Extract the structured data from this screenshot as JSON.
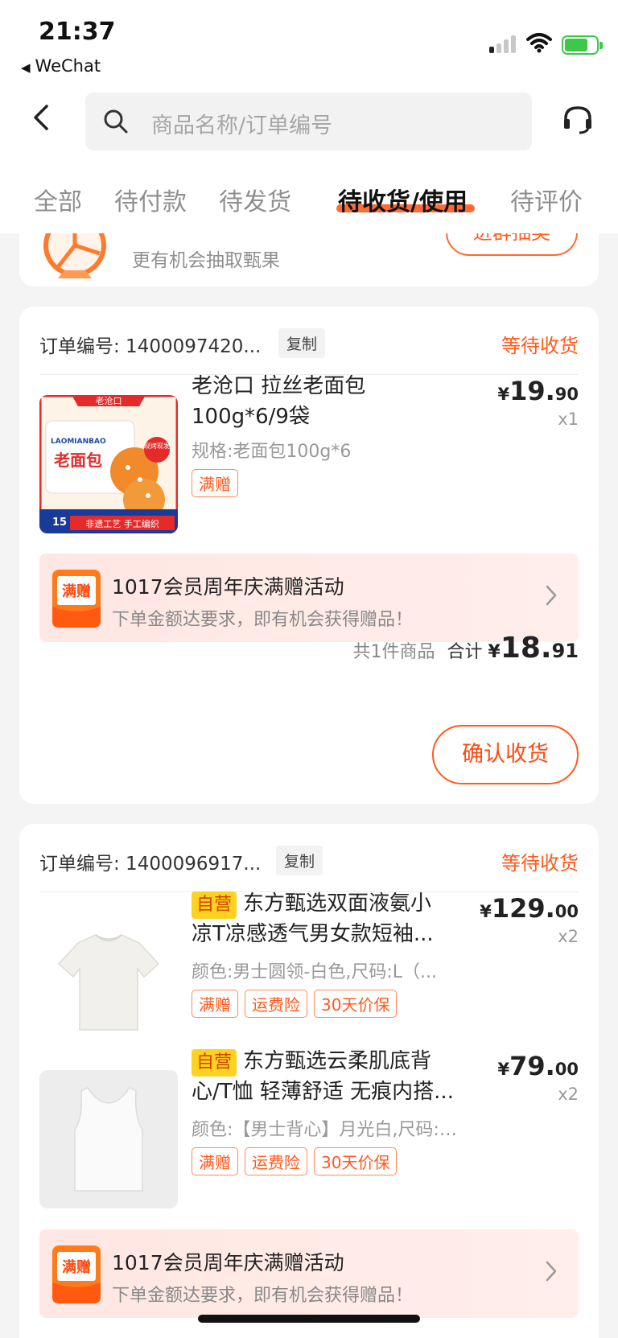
{
  "status_bar": {
    "time": "21:37",
    "back_app": "WeChat"
  },
  "header": {
    "search_placeholder": "商品名称/订单编号"
  },
  "tabs": [
    {
      "label": "全部",
      "active": false
    },
    {
      "label": "待付款",
      "active": false
    },
    {
      "label": "待发货",
      "active": false
    },
    {
      "label": "待收货/使用",
      "active": true
    },
    {
      "label": "待评价",
      "active": false
    }
  ],
  "prev_card": {
    "subtitle": "更有机会抽取甄果",
    "button": "进群抽奖"
  },
  "orders": [
    {
      "order_no_label": "订单编号: 1400097420...",
      "copy": "复制",
      "status": "等待收货",
      "items": [
        {
          "title_line1": "老沧口 拉丝老面包",
          "title_line2": "100g*6/9袋",
          "spec": "规格:老面包100g*6",
          "tags": [
            "满赠"
          ],
          "price_symbol": "¥",
          "price_int": "19.",
          "price_dec": "90",
          "qty": "x1",
          "thumb": {
            "brand": "老沧口",
            "line1": "LAOMIANBAO",
            "line2": "老面包",
            "badge": "现烤现发",
            "bottom": "非遗工艺 手工编织",
            "num": "15"
          }
        }
      ],
      "promo": {
        "badge": "满赠",
        "title": "1017会员周年庆满赠活动",
        "sub": "下单金额达要求，即有机会获得赠品！"
      },
      "summary": {
        "count": "共1件商品",
        "total_label": "合计",
        "symbol": "¥",
        "int": "18.",
        "dec": "91"
      },
      "confirm": "确认收货"
    },
    {
      "order_no_label": "订单编号: 1400096917...",
      "copy": "复制",
      "status": "等待收货",
      "items": [
        {
          "self_badge": "自营",
          "title_line1": "东方甄选双面液氨小",
          "title_line2": "凉T凉感透气男女款短袖...",
          "spec": "颜色:男士圆领-白色,尺码:L（...",
          "tags": [
            "满赠",
            "运费险",
            "30天价保"
          ],
          "price_symbol": "¥",
          "price_int": "129.",
          "price_dec": "00",
          "qty": "x2"
        },
        {
          "self_badge": "自营",
          "title_line1": "东方甄选云柔肌底背",
          "title_line2": "心/T恤 轻薄舒适 无痕内搭...",
          "spec": "颜色:【男士背心】月光白,尺码:L...",
          "tags": [
            "满赠",
            "运费险",
            "30天价保"
          ],
          "price_symbol": "¥",
          "price_int": "79.",
          "price_dec": "00",
          "qty": "x2"
        }
      ],
      "promo": {
        "badge": "满赠",
        "title": "1017会员周年庆满赠活动",
        "sub": "下单金额达要求，即有机会获得赠品！"
      }
    }
  ],
  "colors": {
    "accent": "#ff5a1f",
    "badge_yellow": "#ffd21f",
    "promo_bg": "#ffe7e3"
  }
}
